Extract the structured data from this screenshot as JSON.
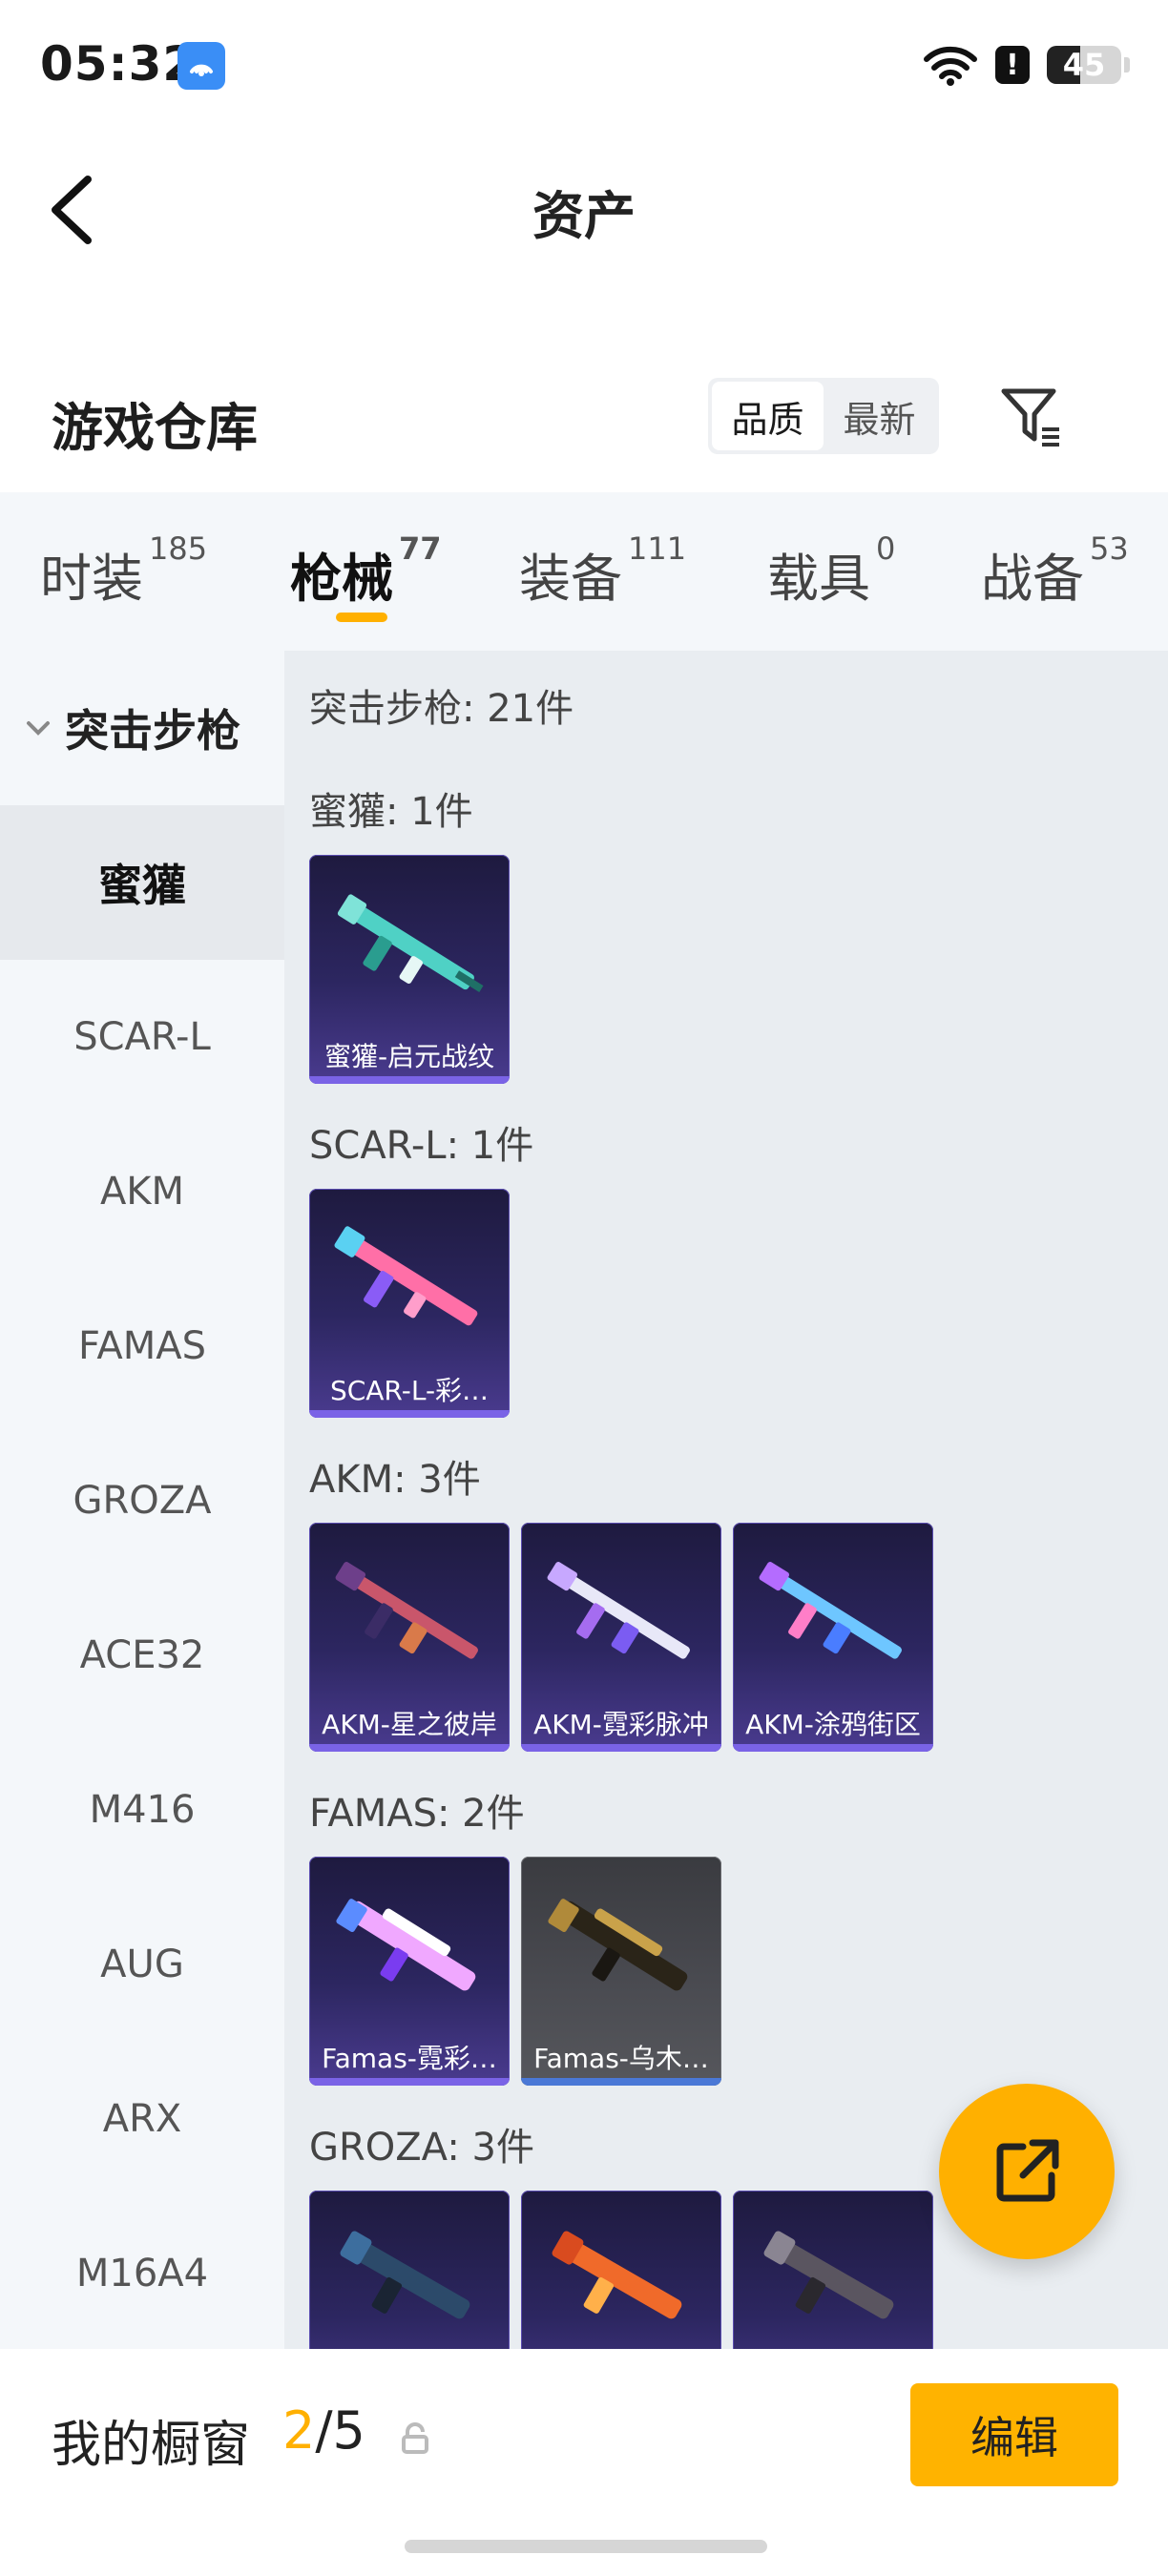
{
  "status_bar": {
    "time": "05:32",
    "battery": "45",
    "battery_level": 0.45
  },
  "header": {
    "title": "资产"
  },
  "section": {
    "heading": "游戏仓库",
    "sort_options": [
      "品质",
      "最新"
    ],
    "sort_selected": "品质"
  },
  "tabs": [
    {
      "label": "时装",
      "count": "185"
    },
    {
      "label": "枪械",
      "count": "77",
      "active": true
    },
    {
      "label": "装备",
      "count": "111"
    },
    {
      "label": "载具",
      "count": "0"
    },
    {
      "label": "战备",
      "count": "53"
    }
  ],
  "sidebar": {
    "category": "突击步枪",
    "items": [
      "蜜獾",
      "SCAR-L",
      "AKM",
      "FAMAS",
      "GROZA",
      "ACE32",
      "M416",
      "AUG",
      "ARX",
      "M16A4"
    ],
    "selected": "蜜獾"
  },
  "content": {
    "summary": "突击步枪: 21件",
    "groups": [
      {
        "title": "蜜獾: 1件",
        "items": [
          {
            "label": "蜜獾-启元战纹"
          }
        ]
      },
      {
        "title": "SCAR-L: 1件",
        "items": [
          {
            "label": "SCAR-L-彩…"
          }
        ]
      },
      {
        "title": "AKM: 3件",
        "items": [
          {
            "label": "AKM-星之彼岸"
          },
          {
            "label": "AKM-霓彩脉冲"
          },
          {
            "label": "AKM-涂鸦街区"
          }
        ]
      },
      {
        "title": "FAMAS: 2件",
        "items": [
          {
            "label": "Famas-霓彩…"
          },
          {
            "label": "Famas-乌木…"
          }
        ]
      },
      {
        "title": "GROZA: 3件",
        "items": [
          {
            "label": ""
          },
          {
            "label": ""
          },
          {
            "label": ""
          }
        ]
      }
    ]
  },
  "bottom_bar": {
    "label": "我的橱窗",
    "current": "2",
    "sep_total": "/5",
    "edit_label": "编辑"
  },
  "colors": {
    "accent": "#ffb000",
    "card_purple": "#2c2660",
    "card_grey": "#4b4c52"
  }
}
